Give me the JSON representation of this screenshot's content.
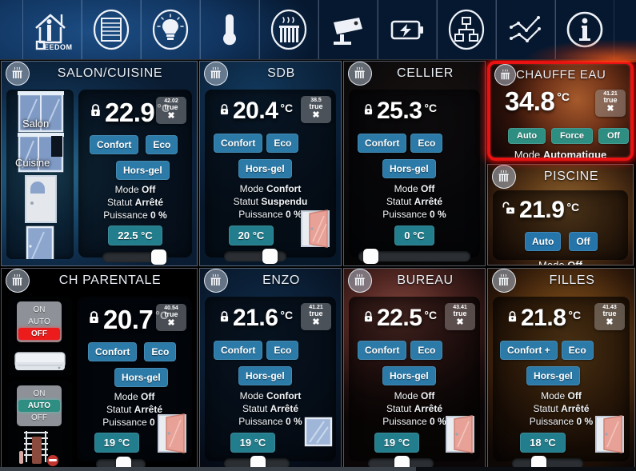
{
  "header": {
    "brand_label": "EEDOM",
    "nav_items": [
      {
        "name": "home-jeedom",
        "icon": "house-icon",
        "label": "JEEDOM"
      },
      {
        "name": "shutters",
        "icon": "rolling-shutter-icon",
        "label": "Volets"
      },
      {
        "name": "lighting",
        "icon": "lightbulb-icon",
        "label": "Lumières"
      },
      {
        "name": "temperature",
        "icon": "thermometer-icon",
        "label": "Températures"
      },
      {
        "name": "heating",
        "icon": "radiator-icon",
        "label": "Chauffage"
      },
      {
        "name": "cameras",
        "icon": "camera-icon",
        "label": "Caméras"
      },
      {
        "name": "energy",
        "icon": "battery-bolt-icon",
        "label": "Énergie"
      },
      {
        "name": "network",
        "icon": "network-icon",
        "label": "Réseau"
      },
      {
        "name": "graphs",
        "icon": "line-chart-icon",
        "label": "Graphiques"
      },
      {
        "name": "info",
        "icon": "info-circle-icon",
        "label": "Informations"
      }
    ]
  },
  "cards": [
    {
      "id": "salon-cuisine",
      "title": "SALON/CUISINE",
      "icon": "radiator-icon",
      "lock": "locked",
      "temperature": "22.9",
      "unit": "°C",
      "badge": {
        "value": "42.02",
        "degree": "°",
        "state": "true",
        "mark": "✖"
      },
      "buttons": [
        "Confort",
        "Eco",
        "Hors-gel"
      ],
      "mode_label": "Mode",
      "mode_value": "Off",
      "status_label": "Statut",
      "status_value": "Arrêté",
      "power_label": "Puissance",
      "power_value": "0 %",
      "setpoint": "22.5 °C",
      "slider_percent": 86,
      "left_widgets": {
        "room_labels": [
          "Salon",
          "Cuisine"
        ],
        "images": [
          "window-icon",
          "window-icon",
          "door-icon",
          "window-icon"
        ]
      },
      "selected": false
    },
    {
      "id": "sdb",
      "title": "SDB",
      "icon": "radiator-icon",
      "lock": "locked",
      "temperature": "20.4",
      "unit": "°C",
      "badge": {
        "value": "38.5",
        "degree": "°",
        "state": "true",
        "mark": "✖"
      },
      "buttons": [
        "Confort",
        "Eco",
        "Hors-gel"
      ],
      "mode_label": "Mode",
      "mode_value": "Confort",
      "status_label": "Statut",
      "status_value": "Suspendu",
      "power_label": "Puissance",
      "power_value": "0 %",
      "setpoint": "20 °C",
      "slider_percent": 74,
      "door_image": "open-door-icon",
      "selected": false
    },
    {
      "id": "cellier",
      "title": "CELLIER",
      "icon": "radiator-icon",
      "lock": "locked",
      "temperature": "25.3",
      "unit": "°C",
      "badge": null,
      "buttons": [
        "Confort",
        "Eco",
        "Hors-gel"
      ],
      "mode_label": "Mode",
      "mode_value": "Off",
      "status_label": "Statut",
      "status_value": "Arrêté",
      "power_label": "Puissance",
      "power_value": "0 %",
      "setpoint": "0 °C",
      "slider_percent": 7,
      "selected": false
    },
    {
      "id": "chauffe-eau",
      "title": "CHAUFFE EAU",
      "icon": "radiator-icon",
      "lock": "none",
      "temperature": "34.8",
      "unit": "°C",
      "badge": {
        "value": "41.21",
        "degree": "°",
        "state": "true",
        "mark": "✖"
      },
      "buttons": [
        "Auto",
        "Force",
        "Off"
      ],
      "mode_label": "Mode",
      "mode_value": "Automatique",
      "selected": true
    },
    {
      "id": "piscine",
      "title": "PISCINE",
      "icon": "radiator-icon",
      "lock": "unlocked",
      "temperature": "21.9",
      "unit": "°C",
      "badge": null,
      "buttons": [
        "Auto",
        "Off"
      ],
      "mode_label": "Mode",
      "mode_value": "Off",
      "selected": false
    },
    {
      "id": "ch-parentale",
      "title": "CH PARENTALE",
      "icon": "radiator-icon",
      "lock": "locked",
      "temperature": "20.7",
      "unit": "°C",
      "badge": {
        "value": "40.54",
        "degree": "°",
        "state": "true",
        "mark": "✖"
      },
      "buttons": [
        "Confort",
        "Eco",
        "Hors-gel"
      ],
      "mode_label": "Mode",
      "mode_value": "Off",
      "status_label": "Statut",
      "status_value": "Arrêté",
      "power_label": "Puissance",
      "power_value": "0 %",
      "setpoint": "19 °C",
      "slider_percent": 57,
      "door_image": "open-door-icon",
      "left_widgets": {
        "selector_1": {
          "options": [
            "ON",
            "AUTO",
            "OFF"
          ],
          "active": "OFF",
          "active_color": "#ec1c1c",
          "device": "air-conditioner-icon"
        },
        "selector_2": {
          "options": [
            "ON",
            "AUTO",
            "OFF"
          ],
          "active": "AUTO",
          "active_color": "#2e8e82",
          "device": "towel-radiator-icon"
        }
      },
      "selected": false
    },
    {
      "id": "enzo",
      "title": "ENZO",
      "icon": "radiator-icon",
      "lock": "locked",
      "temperature": "21.6",
      "unit": "°C",
      "badge": {
        "value": "41.21",
        "degree": "°",
        "state": "true",
        "mark": "✖"
      },
      "buttons": [
        "Confort",
        "Eco",
        "Hors-gel"
      ],
      "mode_label": "Mode",
      "mode_value": "Confort",
      "status_label": "Statut",
      "status_value": "Arrêté",
      "power_label": "Puissance",
      "power_value": "0 %",
      "setpoint": "19 °C",
      "slider_percent": 53,
      "door_image": "window-icon",
      "selected": false
    },
    {
      "id": "bureau",
      "title": "BUREAU",
      "icon": "radiator-icon",
      "lock": "locked",
      "temperature": "22.5",
      "unit": "°C",
      "badge": {
        "value": "43.41",
        "degree": "°",
        "state": "true",
        "mark": "✖"
      },
      "buttons": [
        "Confort",
        "Eco",
        "Hors-gel"
      ],
      "mode_label": "Mode",
      "mode_value": "Off",
      "status_label": "Statut",
      "status_value": "Arrêté",
      "power_label": "Puissance",
      "power_value": "0 %",
      "setpoint": "19 °C",
      "slider_percent": 53,
      "door_image": "open-door-icon",
      "selected": false
    },
    {
      "id": "filles",
      "title": "FILLES",
      "icon": "radiator-icon",
      "lock": "locked",
      "temperature": "21.8",
      "unit": "°C",
      "badge": {
        "value": "41.43",
        "degree": "°",
        "state": "true",
        "mark": "✖"
      },
      "buttons": [
        "Confort +",
        "Eco",
        "Hors-gel"
      ],
      "mode_label": "Mode",
      "mode_value": "Off",
      "status_label": "Statut",
      "status_value": "Arrêté",
      "power_label": "Puissance",
      "power_value": "0 %",
      "setpoint": "18 °C",
      "slider_percent": 38,
      "door_image": "open-door-icon",
      "selected": false
    }
  ],
  "colors": {
    "accent_blue": "#2c7aa8",
    "accent_teal": "#2e8e82",
    "selection_red": "#e81212",
    "off_red": "#ec1c1c"
  }
}
